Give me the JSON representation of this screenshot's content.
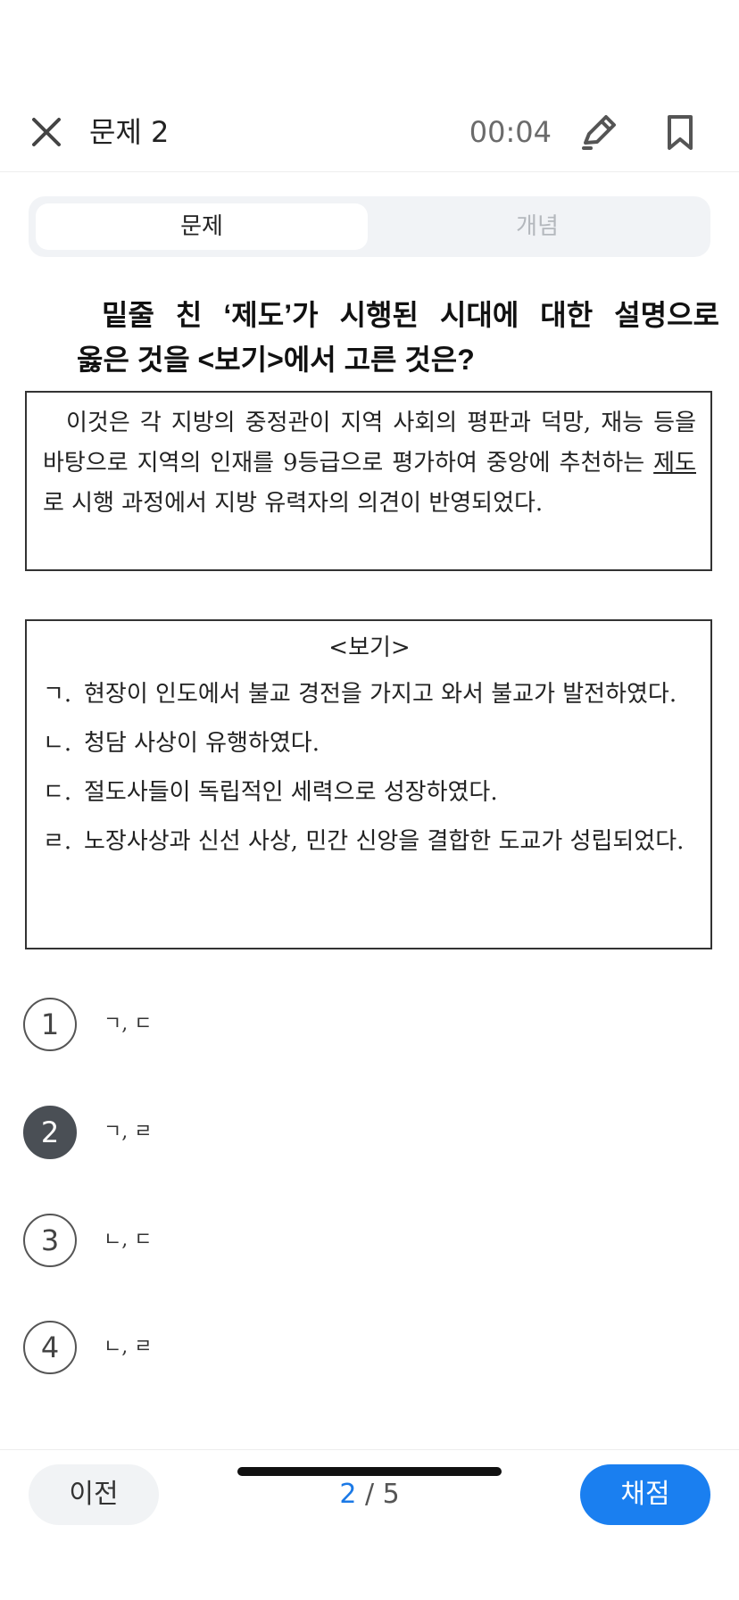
{
  "header": {
    "title": "문제 2",
    "timer": "00:04"
  },
  "tabs": [
    {
      "label": "문제",
      "active": true
    },
    {
      "label": "개념",
      "active": false
    }
  ],
  "question": {
    "line1": "밑줄 친 ‘제도’가 시행된 시대에 대한 설명으로",
    "line2": "옳은 것을 <보기>에서 고른 것은?"
  },
  "passage": {
    "before": "이것은 각 지방의 중정관이 지역 사회의 평판과 덕망, 재능 등을 바탕으로 지역의 인재를 9등급으로 평가하여 중앙에 추천하는 ",
    "underlined": "제도",
    "after": "로 시행 과정에서 지방 유력자의 의견이 반영되었다."
  },
  "bogi": {
    "title": "<보기>",
    "items": [
      {
        "mark": "ㄱ.",
        "text": "현장이 인도에서 불교 경전을 가지고 와서 불교가 발전하였다."
      },
      {
        "mark": "ㄴ.",
        "text": "청담 사상이 유행하였다."
      },
      {
        "mark": "ㄷ.",
        "text": "절도사들이 독립적인 세력으로 성장하였다."
      },
      {
        "mark": "ㄹ.",
        "text": "노장사상과 신선 사상, 민간 신앙을 결합한 도교가 성립되었다."
      }
    ]
  },
  "choices": [
    {
      "num": "1",
      "text": "ㄱ, ㄷ",
      "selected": false
    },
    {
      "num": "2",
      "text": "ㄱ, ㄹ",
      "selected": true
    },
    {
      "num": "3",
      "text": "ㄴ, ㄷ",
      "selected": false
    },
    {
      "num": "4",
      "text": "ㄴ, ㄹ",
      "selected": false
    }
  ],
  "bottom": {
    "prev_label": "이전",
    "page_current": "2",
    "page_sep": " / ",
    "page_total": "5",
    "score_label": "채점"
  },
  "icons": {
    "close": "close-icon",
    "pencil": "pencil-icon",
    "bookmark": "bookmark-icon"
  },
  "colors": {
    "accent": "#1a7ff0",
    "selected_choice": "#4a4f55"
  }
}
